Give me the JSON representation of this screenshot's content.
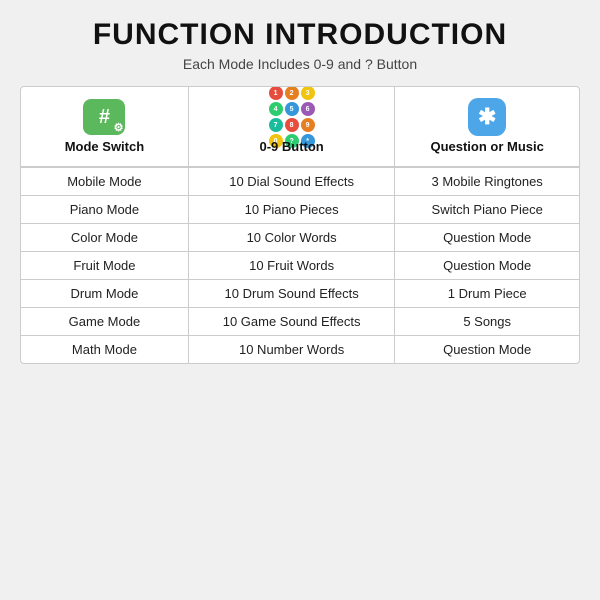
{
  "title": "FUNCTION INTRODUCTION",
  "subtitle": "Each Mode Includes 0-9 and ? Button",
  "columns": [
    {
      "key": "col1",
      "label": "Mode Switch",
      "icon": "mode-switch-icon"
    },
    {
      "key": "col2",
      "label": "0-9 Button",
      "icon": "button-grid-icon"
    },
    {
      "key": "col3",
      "label": "Question or Music",
      "icon": "question-music-icon"
    }
  ],
  "rows": [
    {
      "mode": "Mobile Mode",
      "button": "10 Dial Sound Effects",
      "extra": "3 Mobile Ringtones"
    },
    {
      "mode": "Piano Mode",
      "button": "10 Piano Pieces",
      "extra": "Switch Piano Piece"
    },
    {
      "mode": "Color Mode",
      "button": "10 Color Words",
      "extra": "Question Mode"
    },
    {
      "mode": "Fruit Mode",
      "button": "10 Fruit Words",
      "extra": "Question Mode"
    },
    {
      "mode": "Drum Mode",
      "button": "10 Drum Sound Effects",
      "extra": "1 Drum Piece"
    },
    {
      "mode": "Game Mode",
      "button": "10 Game Sound Effects",
      "extra": "5 Songs"
    },
    {
      "mode": "Math Mode",
      "button": "10 Number Words",
      "extra": "Question Mode"
    }
  ],
  "button_colors": [
    "#e74c3c",
    "#e67e22",
    "#f1c40f",
    "#2ecc71",
    "#3498db",
    "#9b59b6",
    "#1abc9c",
    "#e74c3c",
    "#e67e22",
    "#f1c40f",
    "#2ecc71",
    "#3498db"
  ]
}
